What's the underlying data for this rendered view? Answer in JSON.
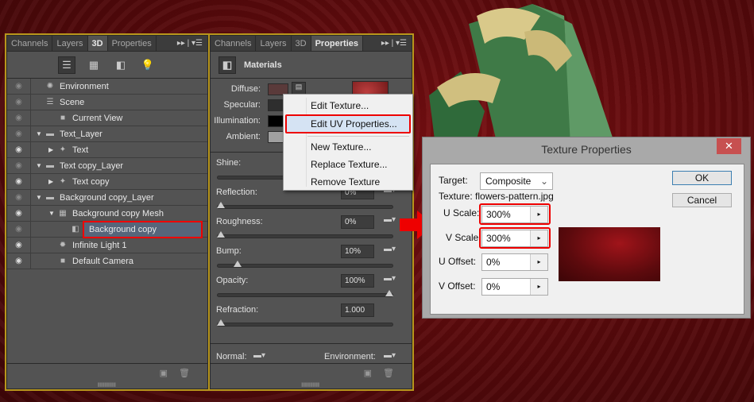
{
  "left_panel": {
    "tabs": [
      "Channels",
      "Layers",
      "3D",
      "Properties"
    ],
    "active_tab": "3D",
    "toolbar_icons": [
      "scene-filter-icon",
      "mesh-filter-icon",
      "material-filter-icon",
      "light-filter-icon"
    ],
    "rows": [
      {
        "label": "Environment",
        "icon": "environment-icon",
        "visible": false,
        "indent": 0,
        "expander": ""
      },
      {
        "label": "Scene",
        "icon": "scene-icon",
        "visible": false,
        "indent": 0,
        "expander": ""
      },
      {
        "label": "Current View",
        "icon": "camera-icon",
        "visible": false,
        "indent": 1,
        "expander": ""
      },
      {
        "label": "Text_Layer",
        "icon": "folder-icon",
        "visible": false,
        "indent": 0,
        "expander": "open"
      },
      {
        "label": "Text",
        "icon": "mesh-star-icon",
        "visible": true,
        "indent": 1,
        "expander": "closed"
      },
      {
        "label": "Text copy_Layer",
        "icon": "folder-icon",
        "visible": false,
        "indent": 0,
        "expander": "open"
      },
      {
        "label": "Text copy",
        "icon": "mesh-star-icon",
        "visible": true,
        "indent": 1,
        "expander": "closed"
      },
      {
        "label": "Background copy_Layer",
        "icon": "folder-icon",
        "visible": false,
        "indent": 0,
        "expander": "open"
      },
      {
        "label": "Background copy Mesh",
        "icon": "mesh-icon",
        "visible": true,
        "indent": 1,
        "expander": "open"
      },
      {
        "label": "Background copy",
        "icon": "material-icon",
        "visible": false,
        "indent": 2,
        "expander": "",
        "selected": true
      },
      {
        "label": "Infinite Light 1",
        "icon": "light-icon",
        "visible": true,
        "indent": 1,
        "expander": ""
      },
      {
        "label": "Default Camera",
        "icon": "camera-icon",
        "visible": true,
        "indent": 1,
        "expander": ""
      }
    ]
  },
  "right_panel": {
    "tabs": [
      "Channels",
      "Layers",
      "3D",
      "Properties"
    ],
    "active_tab": "Properties",
    "header": "Materials",
    "diffuse": "Diffuse:",
    "specular": "Specular:",
    "illumination": "Illumination:",
    "ambient": "Ambient:",
    "colors": {
      "diffuse": "#5a3a3a",
      "specular": "#2e2e2e",
      "illumination": "#000000",
      "ambient": "#a0a0a0"
    },
    "sliders": [
      {
        "label": "Shine:",
        "value": "",
        "percent": null
      },
      {
        "label": "Reflection:",
        "value": "0%",
        "percent": 0
      },
      {
        "label": "Roughness:",
        "value": "0%",
        "percent": 0
      },
      {
        "label": "Bump:",
        "value": "10%",
        "percent": 10
      },
      {
        "label": "Opacity:",
        "value": "100%",
        "percent": 100
      },
      {
        "label": "Refraction:",
        "value": "1.000",
        "percent": 0
      }
    ],
    "normal": "Normal:",
    "environment": "Environment:"
  },
  "context_menu": {
    "items": [
      "Edit Texture...",
      "Edit UV Properties...",
      "New Texture...",
      "Replace Texture...",
      "Remove Texture"
    ],
    "selected": "Edit UV Properties..."
  },
  "dialog": {
    "title": "Texture Properties",
    "close": "✕",
    "target_label": "Target:",
    "target_value": "Composite",
    "texture_label": "Texture:",
    "texture_value": "flowers-pattern.jpg",
    "u_scale_label": "U Scale:",
    "u_scale": "300%",
    "v_scale_label": "V Scale:",
    "v_scale": "300%",
    "u_offset_label": "U Offset:",
    "u_offset": "0%",
    "v_offset_label": "V Offset:",
    "v_offset": "0%",
    "ok": "OK",
    "cancel": "Cancel"
  },
  "accent": {
    "highlight": "#ee0000",
    "panel_border": "#b8961c"
  }
}
